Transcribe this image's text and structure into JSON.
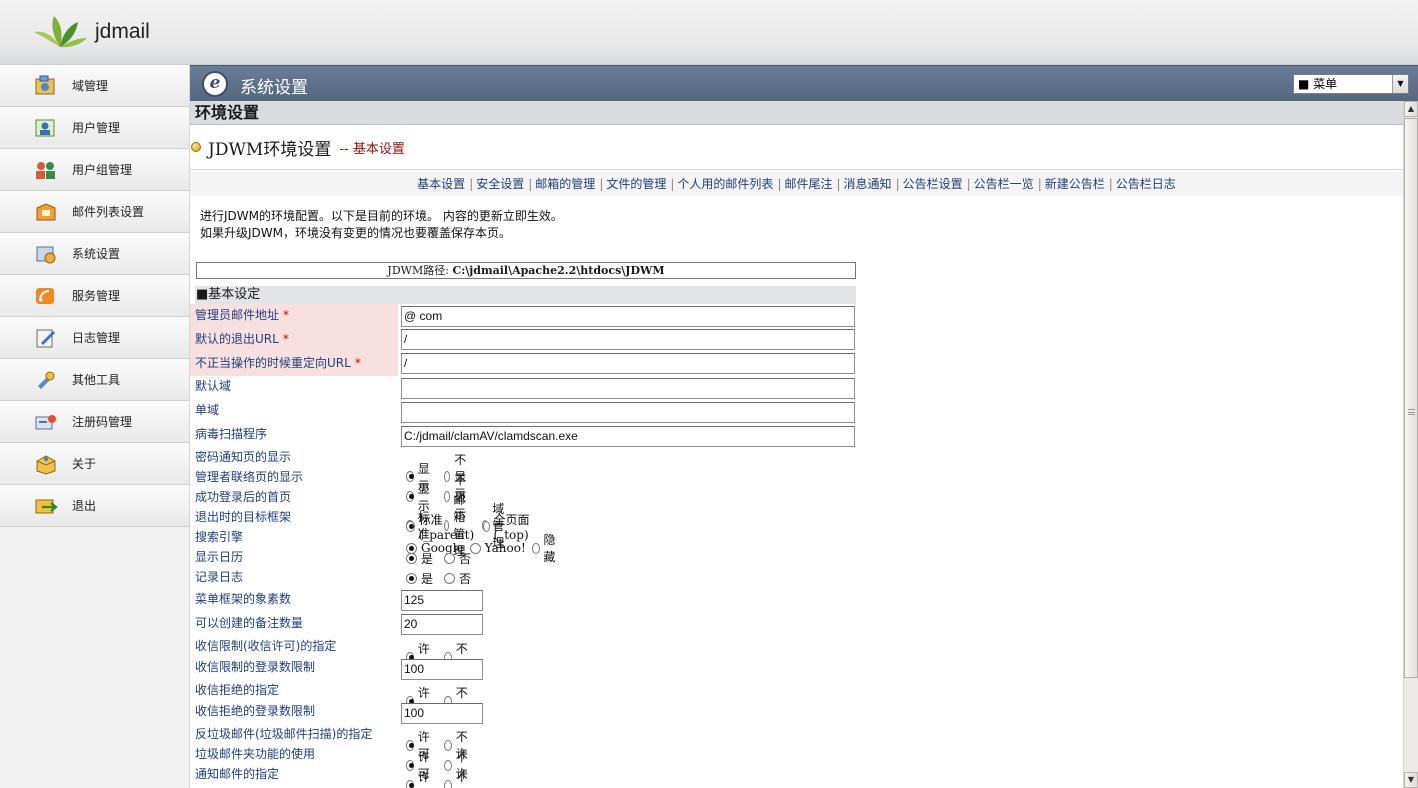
{
  "app": {
    "logo_text": "jdmail"
  },
  "sidebar": {
    "items": [
      {
        "label": "域管理",
        "icon": "domain-icon"
      },
      {
        "label": "用户管理",
        "icon": "user-icon"
      },
      {
        "label": "用户组管理",
        "icon": "group-icon"
      },
      {
        "label": "邮件列表设置",
        "icon": "mail-list-icon"
      },
      {
        "label": "系统设置",
        "icon": "settings-icon"
      },
      {
        "label": "服务管理",
        "icon": "service-icon"
      },
      {
        "label": "日志管理",
        "icon": "log-icon"
      },
      {
        "label": "其他工具",
        "icon": "tools-icon"
      },
      {
        "label": "注册码管理",
        "icon": "license-icon"
      },
      {
        "label": "关于",
        "icon": "about-icon"
      },
      {
        "label": "退出",
        "icon": "logout-icon"
      }
    ]
  },
  "header": {
    "title": "系统设置",
    "menu_select": "■ 菜单"
  },
  "main": {
    "section_title": "环境设置",
    "page_title": "JDWM环境设置",
    "page_subtitle": "-- 基本设置",
    "nav_links": [
      "基本设置",
      "安全设置",
      "邮箱的管理",
      "文件的管理",
      "个人用的邮件列表",
      "邮件尾注",
      "消息通知",
      "公告栏设置",
      "公告栏一览",
      "新建公告栏",
      "公告栏日志"
    ],
    "desc_line1": "进行JDWM的环境配置。以下是目前的环境。 内容的更新立即生效。",
    "desc_line2": "如果升级JDWM，环境没有变更的情况也要覆盖保存本页。",
    "path_label": "JDWM路径: ",
    "path_value": "C:\\jdmail\\Apache2.2\\htdocs\\JDWM",
    "basic_heading": "■基本设定"
  },
  "form": {
    "admin_email": {
      "label": "管理员邮件地址",
      "value": "@ com"
    },
    "logout_url": {
      "label": "默认的退出URL",
      "value": "/"
    },
    "redirect_url": {
      "label": "不正当操作的时候重定向URL",
      "value": "/"
    },
    "default_domain": {
      "label": "默认域",
      "value": ""
    },
    "single_domain": {
      "label": "单域",
      "value": ""
    },
    "virus_scanner": {
      "label": "病毒扫描程序",
      "value": "C:/jdmail/clamAV/clamdscan.exe"
    },
    "pwd_notice": {
      "label": "密码通知页的显示",
      "options": [
        "显示",
        "不显示"
      ],
      "selected": 0
    },
    "admin_contact": {
      "label": "管理者联络页的显示",
      "options": [
        "显示",
        "不显示"
      ],
      "selected": 0
    },
    "home_after_login": {
      "label": "成功登录后的首页",
      "options": [
        "标准",
        "邮箱管理",
        "域管理"
      ],
      "selected": 0
    },
    "logout_target": {
      "label": "退出时的目标框架",
      "options": [
        "标准(_parent)",
        "全页面(_top)"
      ],
      "selected": 0
    },
    "search_engine": {
      "label": "搜索引擎",
      "options": [
        "Google",
        "Yahoo!",
        "隐藏"
      ],
      "selected": 0
    },
    "show_calendar": {
      "label": "显示日历",
      "options": [
        "是",
        "否"
      ],
      "selected": 0
    },
    "record_log": {
      "label": "记录日志",
      "options": [
        "是",
        "否"
      ],
      "selected": 0
    },
    "menu_pixels": {
      "label": "菜单框架的象素数",
      "value": "125"
    },
    "memo_count": {
      "label": "可以创建的备注数量",
      "value": "20"
    },
    "recv_limit": {
      "label": "收信限制(收信许可)的指定",
      "options": [
        "许可",
        "不许"
      ],
      "selected": 0
    },
    "recv_limit_count": {
      "label": "收信限制的登录数限制",
      "value": "100"
    },
    "recv_reject": {
      "label": "收信拒绝的指定",
      "options": [
        "许可",
        "不许"
      ],
      "selected": 0
    },
    "recv_reject_count": {
      "label": "收信拒绝的登录数限制",
      "value": "100"
    },
    "anti_spam": {
      "label": "反垃圾邮件(垃圾邮件扫描)的指定",
      "options": [
        "许可",
        "不许"
      ],
      "selected": 0
    },
    "spam_folder": {
      "label": "垃圾邮件夹功能的使用",
      "options": [
        "许可",
        "不许"
      ],
      "selected": 0
    },
    "notice_mail": {
      "label": "通知邮件的指定",
      "options": [
        "许可",
        "不许"
      ],
      "selected": 0
    }
  }
}
